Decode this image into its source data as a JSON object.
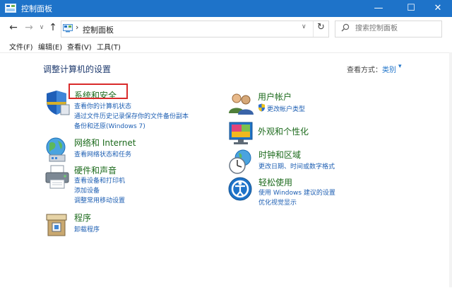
{
  "window": {
    "title": "控制面板",
    "minimize": "—",
    "maximize": "☐",
    "close": "✕"
  },
  "address": {
    "crumb_sep": "›",
    "crumb": "控制面板",
    "dropdown": "∨",
    "refresh": "↻"
  },
  "search": {
    "placeholder": "搜索控制面板"
  },
  "nav": {
    "back": "←",
    "forward": "→",
    "recent": "∨",
    "up": "↑"
  },
  "menu": [
    "文件(F)",
    "编辑(E)",
    "查看(V)",
    "工具(T)"
  ],
  "heading": "调整计算机的设置",
  "view_by": {
    "label": "查看方式：",
    "value": "类别",
    "caret": "▾"
  },
  "left_categories": [
    {
      "title": "系统和安全",
      "links": [
        "查看你的计算机状态",
        "通过文件历史记录保存你的文件备份副本",
        "备份和还原(Windows 7)"
      ]
    },
    {
      "title": "网络和 Internet",
      "links": [
        "查看网络状态和任务"
      ]
    },
    {
      "title": "硬件和声音",
      "links": [
        "查看设备和打印机",
        "添加设备",
        "调整常用移动设置"
      ]
    },
    {
      "title": "程序",
      "links": [
        "卸载程序"
      ]
    }
  ],
  "right_categories": [
    {
      "title": "用户帐户",
      "links": [
        "更改帐户类型"
      ]
    },
    {
      "title": "外观和个性化",
      "links": []
    },
    {
      "title": "时钟和区域",
      "links": [
        "更改日期、时间或数字格式"
      ]
    },
    {
      "title": "轻松使用",
      "links": [
        "使用 Windows 建议的设置",
        "优化视觉显示"
      ]
    }
  ],
  "colors": {
    "titlebar": "#1e73c9",
    "category_title": "#1d6b1d",
    "link": "#1e5fb3",
    "highlight": "#d92b2b"
  }
}
